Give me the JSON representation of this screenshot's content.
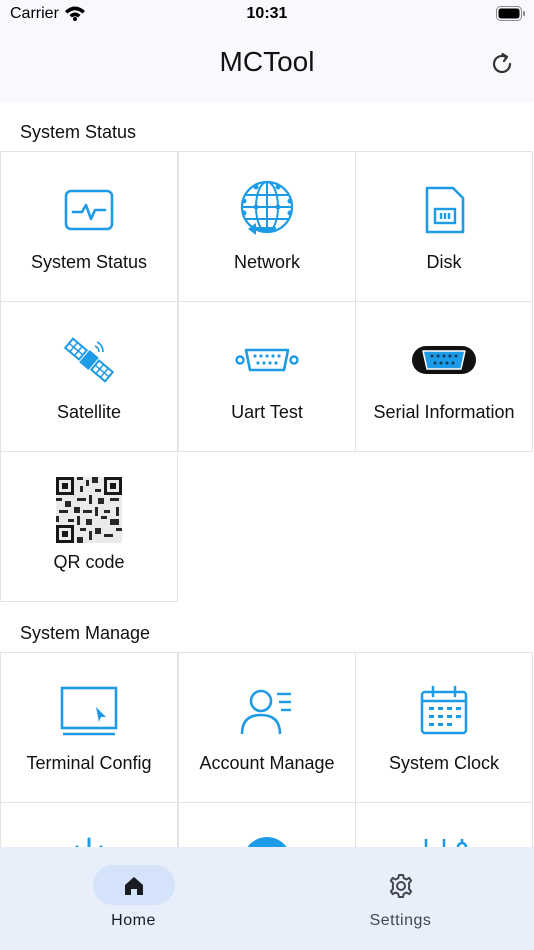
{
  "status_bar": {
    "carrier": "Carrier",
    "time": "10:31"
  },
  "nav": {
    "title": "MCTool"
  },
  "sections": [
    {
      "title": "System Status",
      "items": [
        {
          "label": "System Status",
          "icon": "monitor-pulse-icon"
        },
        {
          "label": "Network",
          "icon": "globe-network-icon"
        },
        {
          "label": "Disk",
          "icon": "sd-card-icon"
        },
        {
          "label": "Satellite",
          "icon": "satellite-icon"
        },
        {
          "label": "Uart Test",
          "icon": "serial-port-icon"
        },
        {
          "label": "Serial Information",
          "icon": "serial-connector-icon"
        },
        {
          "label": "QR code",
          "icon": "qr-code-icon"
        }
      ]
    },
    {
      "title": "System Manage",
      "items": [
        {
          "label": "Terminal Config",
          "icon": "terminal-screen-icon"
        },
        {
          "label": "Account Manage",
          "icon": "account-user-icon"
        },
        {
          "label": "System Clock",
          "icon": "calendar-clock-icon"
        },
        {
          "label": "",
          "icon": "code-icon"
        },
        {
          "label": "",
          "icon": "globe-icon"
        },
        {
          "label": "",
          "icon": "sliders-icon"
        }
      ]
    }
  ],
  "tabs": [
    {
      "label": "Home",
      "icon": "home-icon",
      "active": true
    },
    {
      "label": "Settings",
      "icon": "gear-icon",
      "active": false
    }
  ],
  "colors": {
    "accent": "#1e9be6",
    "tab_bar_bg": "#e8eefa",
    "active_pill": "#d4e3f9",
    "nav_bg": "#f8f9fc"
  }
}
